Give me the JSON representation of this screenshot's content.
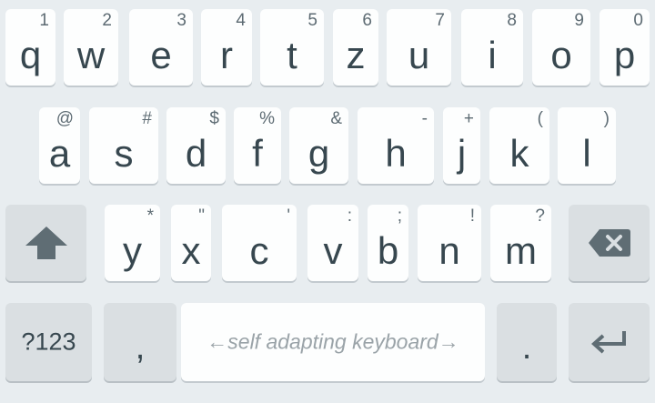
{
  "keyboard": {
    "row1": [
      {
        "label": "q",
        "hint": "1"
      },
      {
        "label": "w",
        "hint": "2"
      },
      {
        "label": "e",
        "hint": "3"
      },
      {
        "label": "r",
        "hint": "4"
      },
      {
        "label": "t",
        "hint": "5"
      },
      {
        "label": "z",
        "hint": "6"
      },
      {
        "label": "u",
        "hint": "7"
      },
      {
        "label": "i",
        "hint": "8"
      },
      {
        "label": "o",
        "hint": "9"
      },
      {
        "label": "p",
        "hint": "0"
      }
    ],
    "row2": [
      {
        "label": "a",
        "hint": "@"
      },
      {
        "label": "s",
        "hint": "#"
      },
      {
        "label": "d",
        "hint": "$"
      },
      {
        "label": "f",
        "hint": "%"
      },
      {
        "label": "g",
        "hint": "&"
      },
      {
        "label": "h",
        "hint": "-"
      },
      {
        "label": "j",
        "hint": "+"
      },
      {
        "label": "k",
        "hint": "("
      },
      {
        "label": "l",
        "hint": ")"
      }
    ],
    "row3": [
      {
        "label": "y",
        "hint": "*"
      },
      {
        "label": "x",
        "hint": "\""
      },
      {
        "label": "c",
        "hint": "'"
      },
      {
        "label": "v",
        "hint": ":"
      },
      {
        "label": "b",
        "hint": ";"
      },
      {
        "label": "n",
        "hint": "!"
      },
      {
        "label": "m",
        "hint": "?"
      }
    ],
    "symbols_label": "?123",
    "comma_label": ",",
    "space_label": "←self adapting keyboard→",
    "period_label": ".",
    "shift_icon": "shift-arrow-icon",
    "backspace_icon": "backspace-icon",
    "enter_icon": "enter-icon",
    "colors": {
      "background": "#e8edf0",
      "key": "#fdfefe",
      "function_key": "#dadfe2",
      "text": "#37474f",
      "icon": "#5f6d74"
    }
  }
}
